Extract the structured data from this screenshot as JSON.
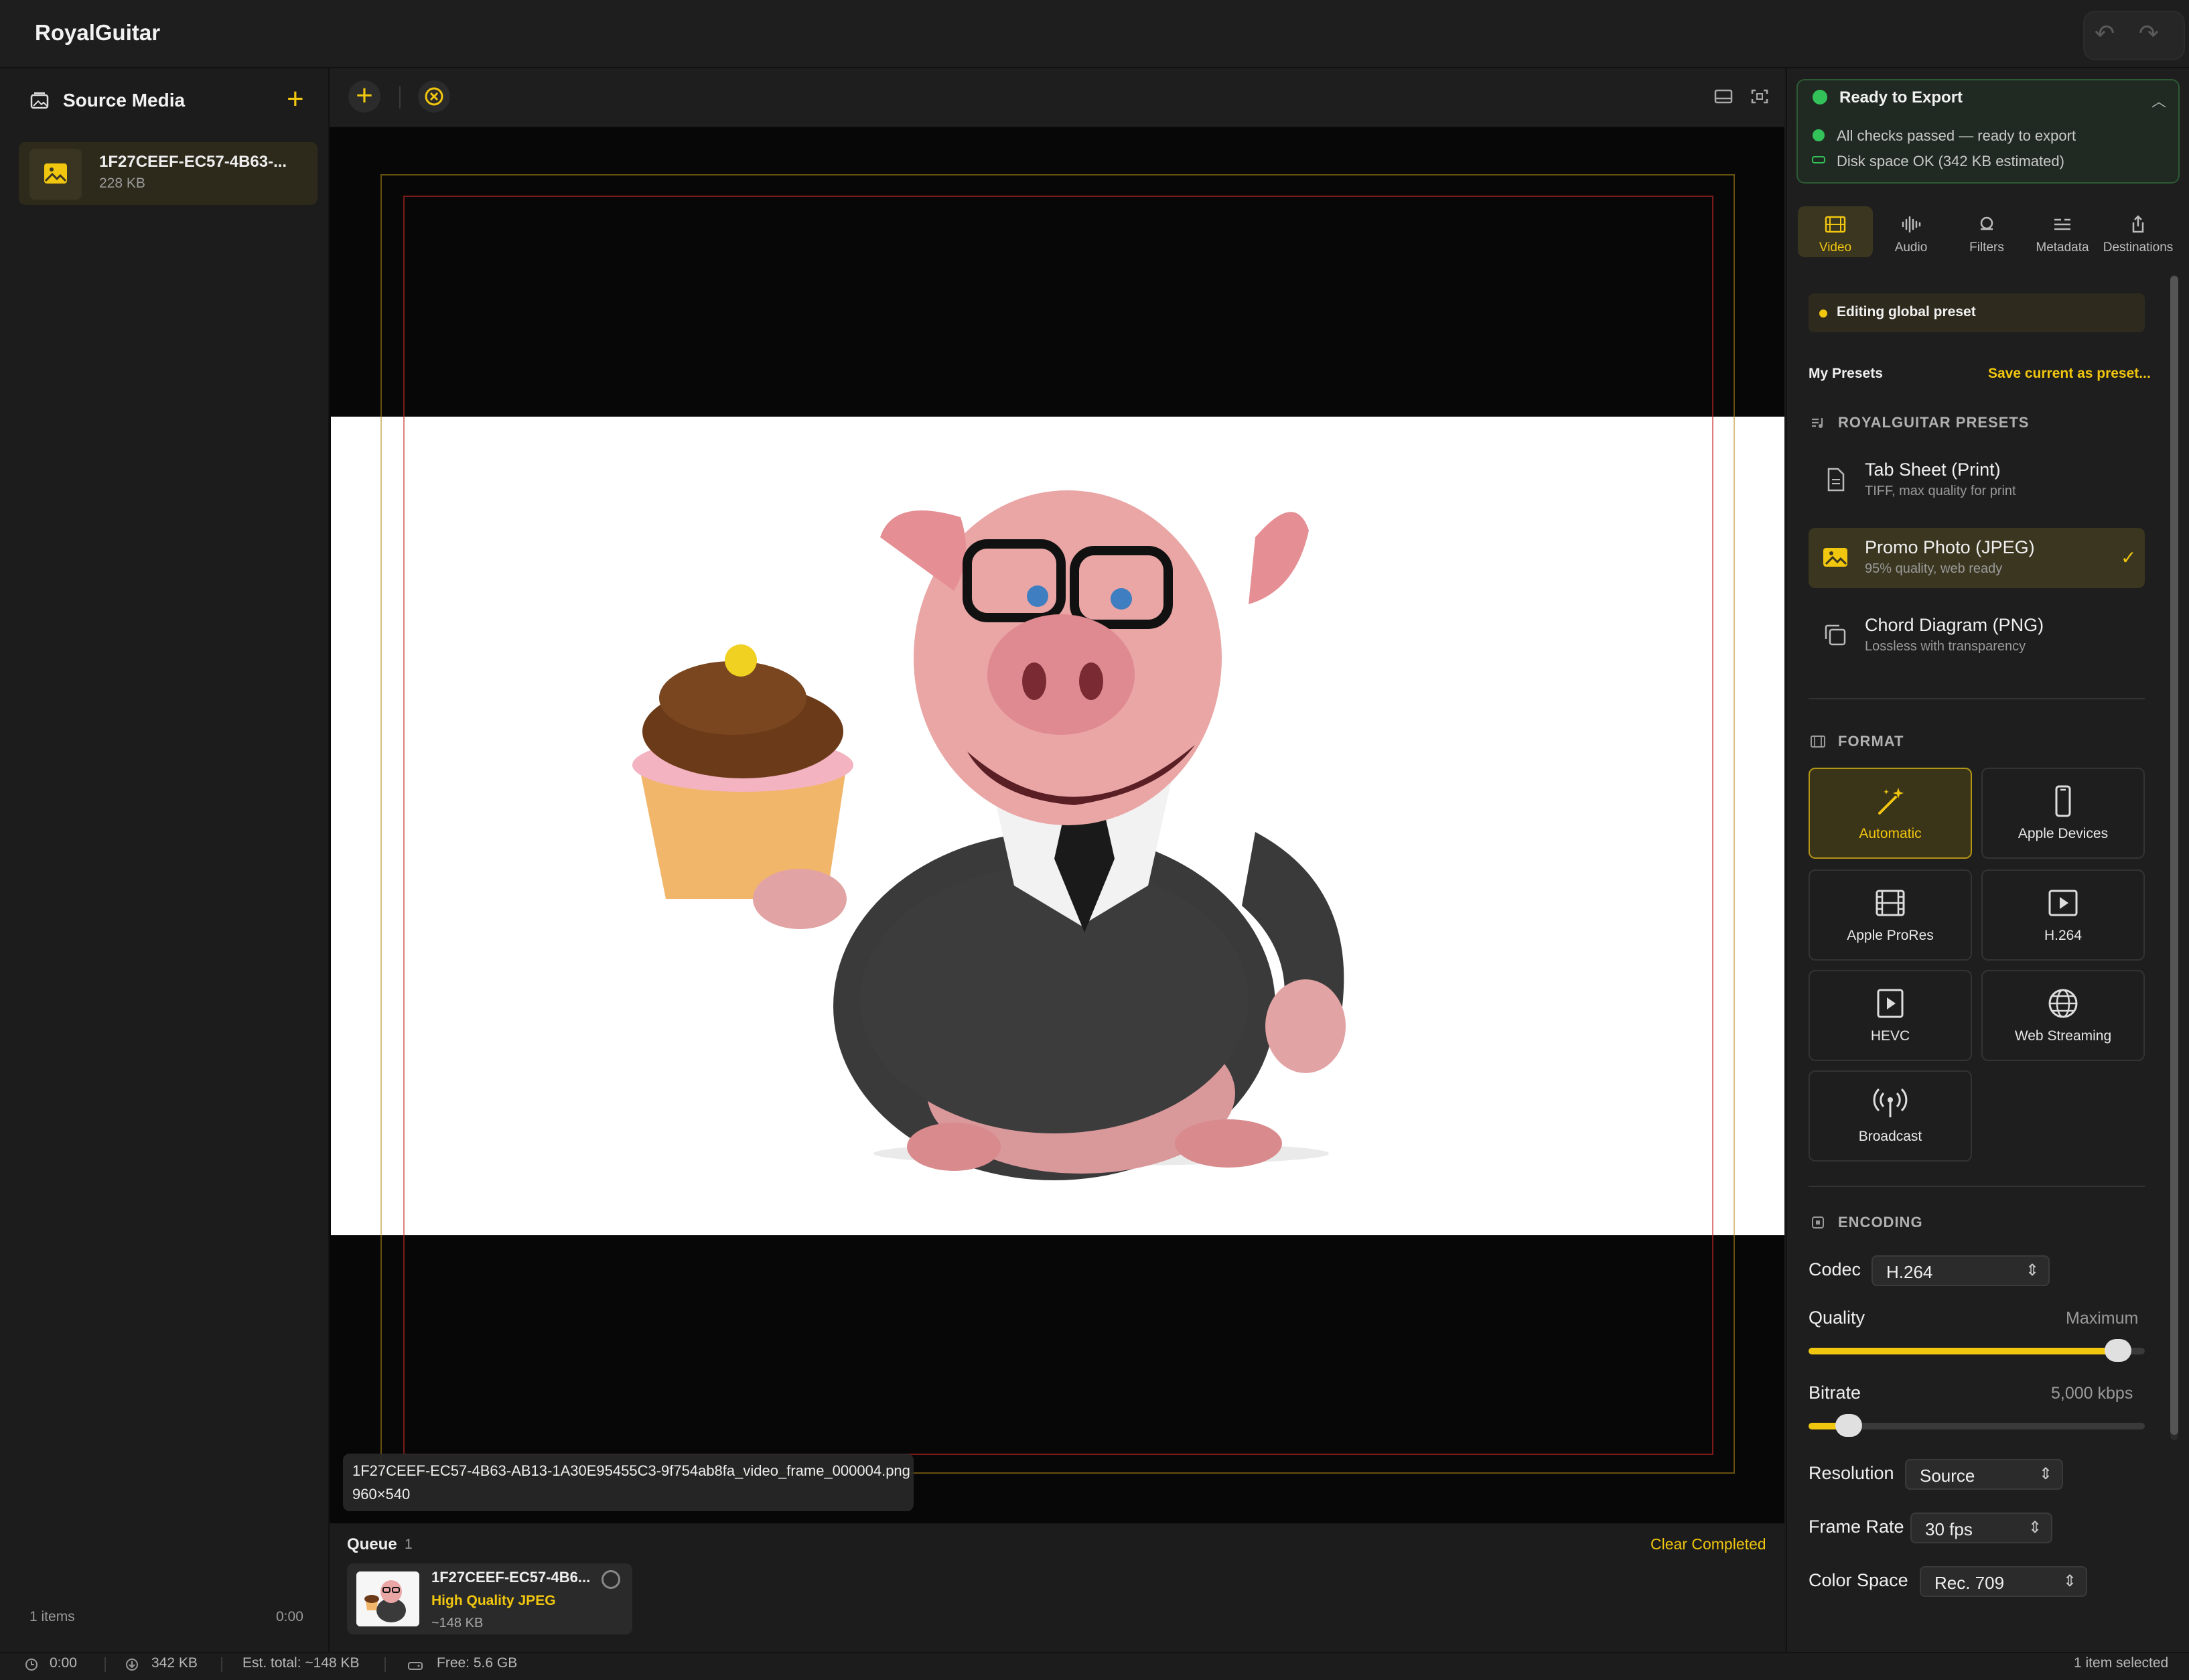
{
  "app": {
    "title": "RoyalGuitar"
  },
  "sidebar": {
    "title": "Source Media",
    "items": [
      {
        "name": "1F27CEEF-EC57-4B63-...",
        "size": "228 KB"
      }
    ],
    "footer_count": "1 items",
    "footer_time": "0:00"
  },
  "canvas": {
    "file_name": "1F27CEEF-EC57-4B63-AB13-1A30E95455C3-9f754ab8fa_video_frame_000004.png",
    "dimensions": "960×540"
  },
  "queue": {
    "title": "Queue",
    "count": "1",
    "clear_label": "Clear Completed",
    "items": [
      {
        "name": "1F27CEEF-EC57-4B6...",
        "preset": "High Quality JPEG",
        "size": "~148 KB"
      }
    ]
  },
  "statusbar": {
    "time": "0:00",
    "size": "342 KB",
    "est_total": "Est. total: ~148 KB",
    "free": "Free: 5.6 GB",
    "selection": "1 item selected"
  },
  "export": {
    "title": "Ready to Export",
    "checks": [
      "All checks passed — ready to export",
      "Disk space OK (342 KB estimated)"
    ]
  },
  "tabs": [
    {
      "label": "Video",
      "icon": "film-icon",
      "active": true
    },
    {
      "label": "Audio",
      "icon": "waveform-icon",
      "active": false
    },
    {
      "label": "Filters",
      "icon": "filters-icon",
      "active": false
    },
    {
      "label": "Metadata",
      "icon": "metadata-icon",
      "active": false
    },
    {
      "label": "Destinations",
      "icon": "share-icon",
      "active": false
    }
  ],
  "settings": {
    "banner": "Editing global preset",
    "my_presets": "My Presets",
    "save_preset": "Save current as preset...",
    "presets_section": "ROYALGUITAR PRESETS",
    "presets": [
      {
        "name": "Tab Sheet (Print)",
        "sub": "TIFF, max quality for print",
        "icon": "document-icon",
        "selected": false
      },
      {
        "name": "Promo Photo (JPEG)",
        "sub": "95% quality, web ready",
        "icon": "photo-icon",
        "selected": true
      },
      {
        "name": "Chord Diagram (PNG)",
        "sub": "Lossless with transparency",
        "icon": "layers-icon",
        "selected": false
      }
    ],
    "format_section": "FORMAT",
    "formats": [
      {
        "label": "Automatic",
        "icon": "magic-wand-icon",
        "selected": true
      },
      {
        "label": "Apple Devices",
        "icon": "iphone-icon",
        "selected": false
      },
      {
        "label": "Apple ProRes",
        "icon": "film-strip-icon",
        "selected": false
      },
      {
        "label": "H.264",
        "icon": "play-icon",
        "selected": false
      },
      {
        "label": "HEVC",
        "icon": "play-icon",
        "selected": false
      },
      {
        "label": "Web Streaming",
        "icon": "globe-icon",
        "selected": false
      },
      {
        "label": "Broadcast",
        "icon": "antenna-icon",
        "selected": false
      }
    ],
    "encoding_section": "ENCODING",
    "codec_label": "Codec",
    "codec_value": "H.264",
    "quality_label": "Quality",
    "quality_value": "Maximum",
    "quality_level": 0.92,
    "bitrate_label": "Bitrate",
    "bitrate_value": "5,000 kbps",
    "bitrate_level": 0.12,
    "resolution_label": "Resolution",
    "resolution_value": "Source",
    "framerate_label": "Frame Rate",
    "framerate_value": "30 fps",
    "colorspace_label": "Color Space",
    "colorspace_value": "Rec. 709"
  },
  "colors": {
    "accent": "#f1c60f",
    "success": "#33c25a",
    "background": "#1b1b1b"
  }
}
